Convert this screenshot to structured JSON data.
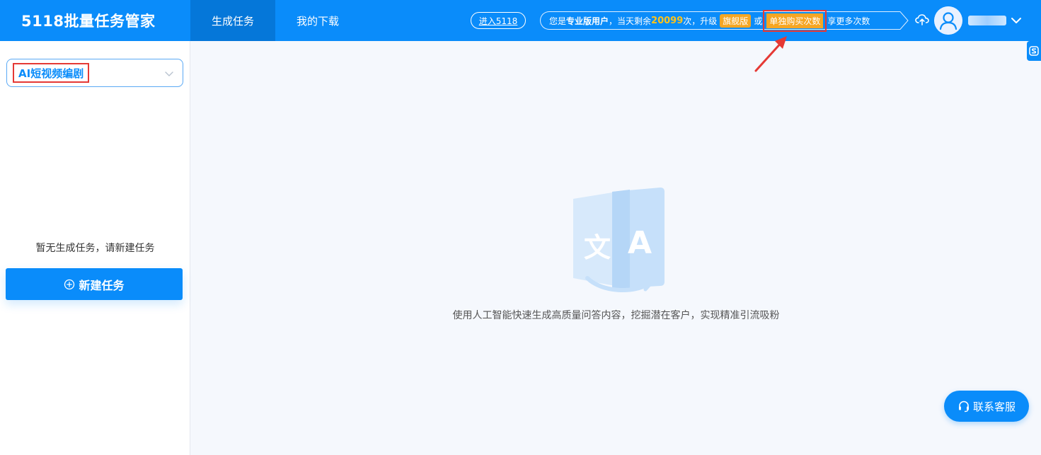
{
  "header": {
    "logo": "5118批量任务管家",
    "tabs": [
      {
        "label": "生成任务",
        "active": true
      },
      {
        "label": "我的下载",
        "active": false
      }
    ],
    "enter_link": "进入5118",
    "status": {
      "prefix": "您是",
      "user_type": "专业版用户",
      "mid1": "，当天剩余",
      "remaining": "20099",
      "mid2": "次，升级",
      "flagship_badge": "旗舰版",
      "or": "或",
      "buy_badge": "单独购买次数",
      "suffix": "享更多次数"
    },
    "icons": {
      "upload": "cloud-upload-icon",
      "avatar": "user-avatar-icon",
      "menu": "chevron-down-icon"
    }
  },
  "sidebar": {
    "select_value": "AI短视频编剧",
    "empty_text": "暂无生成任务，请新建任务",
    "new_task_label": "新建任务"
  },
  "main": {
    "description": "使用人工智能快速生成高质量问答内容，挖掘潜在客户，实现精准引流吸粉"
  },
  "floating": {
    "service_label": "联系客服"
  },
  "colors": {
    "primary": "#0a8cfa",
    "active_tab": "#0577d9",
    "highlight": "#ffc31a",
    "badge": "#f6a623",
    "annotation": "#e53935"
  }
}
